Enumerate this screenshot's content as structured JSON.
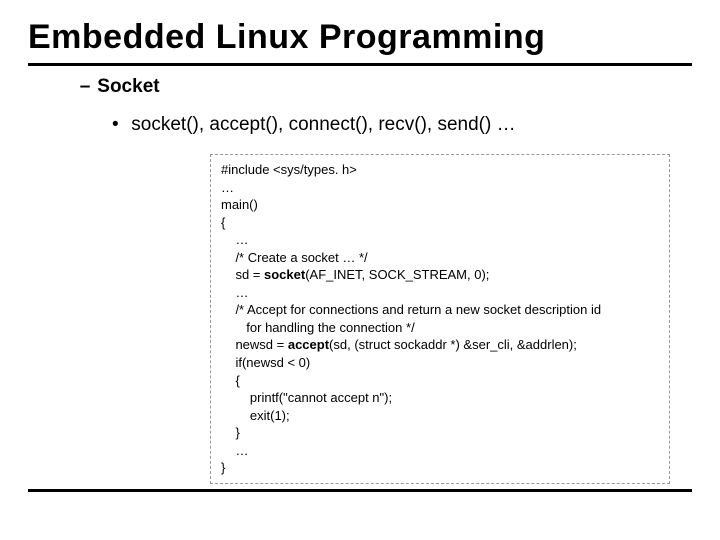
{
  "title": "Embedded Linux Programming",
  "sub1_label": "Socket",
  "sub2_label": "socket(), accept(), connect(), recv(), send() …",
  "code": {
    "l01": "#include <sys/types. h>",
    "l02": "…",
    "l03": "main()",
    "l04": "{",
    "l05": "    …",
    "l06": "    /* Create a socket … */",
    "l07a": "    sd = ",
    "l07b": "socket",
    "l07c": "(AF_INET, SOCK_STREAM, 0);",
    "l08": "    …",
    "l09": "    /* Accept for connections and return a new socket description id",
    "l10": "       for handling the connection */",
    "l11a": "    newsd = ",
    "l11b": "accept",
    "l11c": "(sd, (struct sockaddr *) &ser_cli, &addrlen);",
    "l12": "    if(newsd < 0)",
    "l13": "    {",
    "l14": "        printf(\"cannot accept n\");",
    "l15": "        exit(1);",
    "l16": "    }",
    "l17": "    …",
    "l18": "}"
  }
}
